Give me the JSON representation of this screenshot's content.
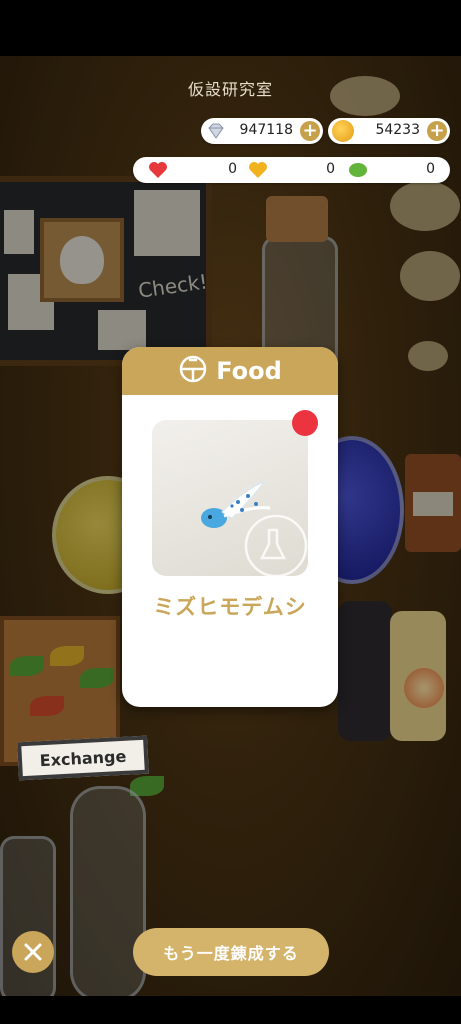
{
  "screen": {
    "title": "仮設研究室"
  },
  "currencies": {
    "gems": {
      "icon": "diamond-icon",
      "value": "947118"
    },
    "coins": {
      "icon": "coin-icon",
      "value": "54233"
    }
  },
  "stats": [
    {
      "icon": "red-heart-brain-icon",
      "color": "#e5393c",
      "value": "0"
    },
    {
      "icon": "yellow-heart-brain-icon",
      "color": "#f0b21e",
      "value": "0"
    },
    {
      "icon": "green-brain-icon",
      "color": "#63b43a",
      "value": "0"
    }
  ],
  "scene": {
    "exchange_sign": "Exchange",
    "blackboard_text": "Check!"
  },
  "result_card": {
    "category": "Food",
    "category_icon": "food-bowl-icon",
    "item_name": "ミズヒモデムシ",
    "item_icon": "bug-creature-icon",
    "new_badge": true
  },
  "actions": {
    "close_icon": "close-icon",
    "again_label": "もう一度錬成する"
  },
  "colors": {
    "accent": "#c9a659",
    "new_badge": "#ec3440"
  }
}
